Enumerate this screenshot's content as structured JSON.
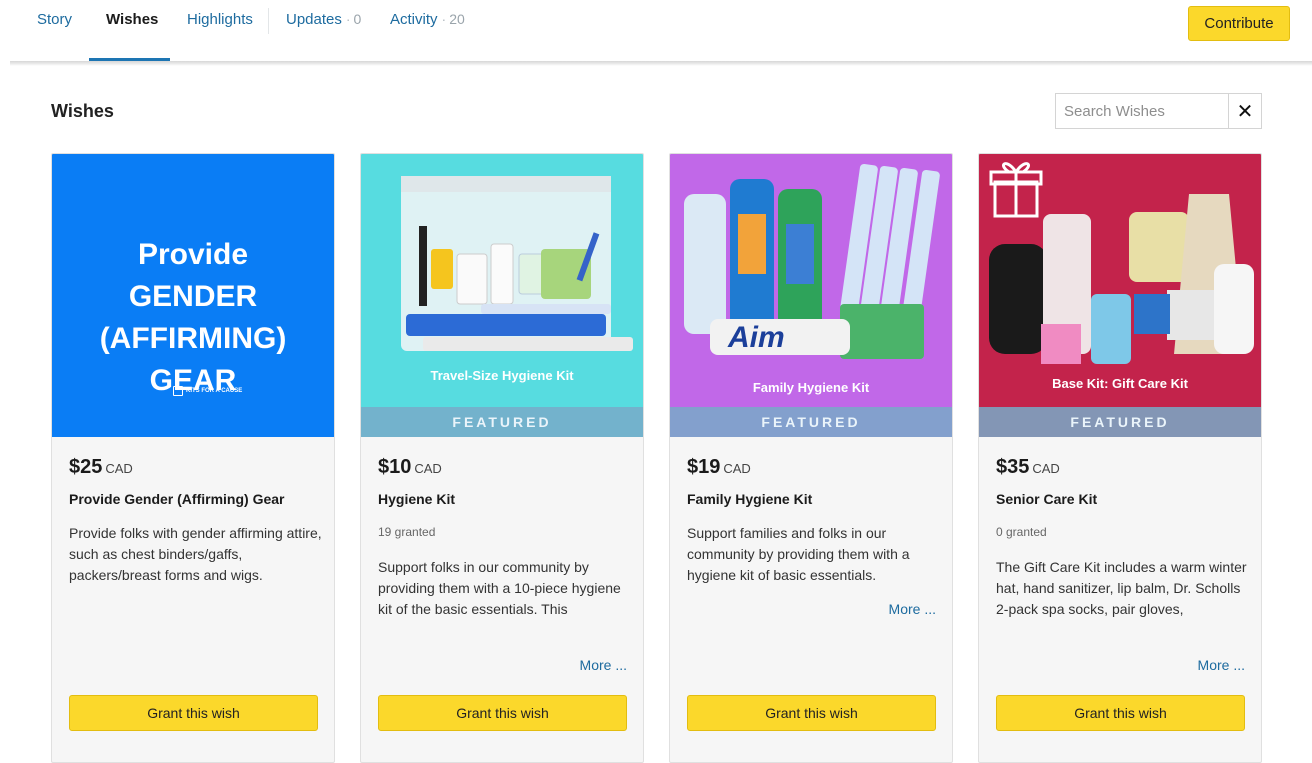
{
  "nav": {
    "tabs": [
      {
        "label": "Story",
        "count": ""
      },
      {
        "label": "Wishes",
        "count": ""
      },
      {
        "label": "Highlights",
        "count": ""
      },
      {
        "label": "Updates",
        "count": "0"
      },
      {
        "label": "Activity",
        "count": "20"
      }
    ],
    "active_tab": "Wishes",
    "contribute_label": "Contribute"
  },
  "section": {
    "title": "Wishes",
    "search_placeholder": "Search Wishes",
    "clear_glyph": "✕"
  },
  "cards": [
    {
      "image_text": "Provide GENDER (AFFIRMING) GEAR",
      "image_logo": "KITS FOR A CAUSE",
      "featured": "",
      "price": "$25",
      "currency": "CAD",
      "title": "Provide Gender (Affirming) Gear",
      "granted": "",
      "description": "Provide folks with gender affirming attire, such as chest binders/gaffs, packers/breast forms and wigs.",
      "more": "",
      "button": "Grant this wish",
      "image_color": "#0a7df5"
    },
    {
      "image_caption": "Travel-Size Hygiene Kit",
      "featured": "FEATURED",
      "price": "$10",
      "currency": "CAD",
      "title": "Hygiene Kit",
      "granted": "19 granted",
      "description": "Support folks in our community by providing them with a 10-piece hygiene kit of the basic essentials. This",
      "more": "More ...",
      "button": "Grant this wish",
      "image_color": "#57dce0"
    },
    {
      "image_caption": "Family Hygiene Kit",
      "featured": "FEATURED",
      "price": "$19",
      "currency": "CAD",
      "title": "Family Hygiene Kit",
      "granted": "",
      "description": "Support families and folks in our community by providing them with a hygiene kit of basic essentials.",
      "more": "More ...",
      "button": "Grant this wish",
      "image_color": "#c168e8"
    },
    {
      "image_caption": "Base Kit: Gift Care Kit",
      "featured": "FEATURED",
      "price": "$35",
      "currency": "CAD",
      "title": "Senior Care Kit",
      "granted": "0 granted",
      "description": "The Gift Care Kit includes a warm winter hat, hand sanitizer, lip balm, Dr. Scholls 2-pack spa socks, pair gloves,",
      "more": "More ...",
      "button": "Grant this wish",
      "image_color": "#c3234b"
    }
  ],
  "colors": {
    "accent_yellow": "#fbd82b",
    "link_blue": "#1d6b9f",
    "tab_underline": "#1d75b3"
  }
}
